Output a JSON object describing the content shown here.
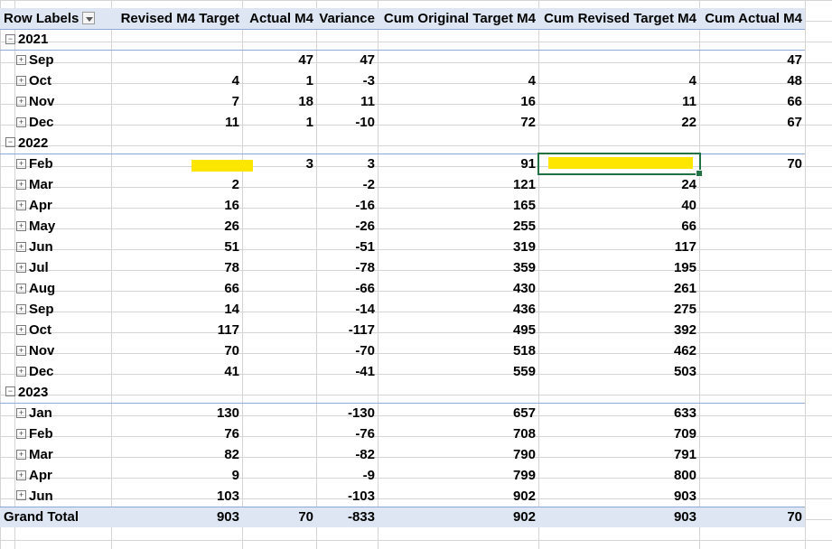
{
  "columns": [
    "Row Labels",
    "Revised M4 Target",
    "Actual M4",
    "Variance",
    "Cum Original Target M4",
    "Cum Revised Target M4",
    "Cum Actual M4"
  ],
  "rows": [
    {
      "kind": "year",
      "label": "2021",
      "values": [
        "",
        "",
        "",
        "",
        "",
        ""
      ]
    },
    {
      "kind": "month",
      "label": "Sep",
      "values": [
        "",
        "47",
        "47",
        "",
        "",
        "47"
      ]
    },
    {
      "kind": "month",
      "label": "Oct",
      "values": [
        "4",
        "1",
        "-3",
        "4",
        "4",
        "48"
      ]
    },
    {
      "kind": "month",
      "label": "Nov",
      "values": [
        "7",
        "18",
        "11",
        "16",
        "11",
        "66"
      ]
    },
    {
      "kind": "month",
      "label": "Dec",
      "values": [
        "11",
        "1",
        "-10",
        "72",
        "22",
        "67"
      ]
    },
    {
      "kind": "year",
      "label": "2022",
      "values": [
        "",
        "",
        "",
        "",
        "",
        ""
      ]
    },
    {
      "kind": "month",
      "label": "Feb",
      "values": [
        "",
        "3",
        "3",
        "91",
        "",
        "70"
      ]
    },
    {
      "kind": "month",
      "label": "Mar",
      "values": [
        "2",
        "",
        "-2",
        "121",
        "24",
        ""
      ]
    },
    {
      "kind": "month",
      "label": "Apr",
      "values": [
        "16",
        "",
        "-16",
        "165",
        "40",
        ""
      ]
    },
    {
      "kind": "month",
      "label": "May",
      "values": [
        "26",
        "",
        "-26",
        "255",
        "66",
        ""
      ]
    },
    {
      "kind": "month",
      "label": "Jun",
      "values": [
        "51",
        "",
        "-51",
        "319",
        "117",
        ""
      ]
    },
    {
      "kind": "month",
      "label": "Jul",
      "values": [
        "78",
        "",
        "-78",
        "359",
        "195",
        ""
      ]
    },
    {
      "kind": "month",
      "label": "Aug",
      "values": [
        "66",
        "",
        "-66",
        "430",
        "261",
        ""
      ]
    },
    {
      "kind": "month",
      "label": "Sep",
      "values": [
        "14",
        "",
        "-14",
        "436",
        "275",
        ""
      ]
    },
    {
      "kind": "month",
      "label": "Oct",
      "values": [
        "117",
        "",
        "-117",
        "495",
        "392",
        ""
      ]
    },
    {
      "kind": "month",
      "label": "Nov",
      "values": [
        "70",
        "",
        "-70",
        "518",
        "462",
        ""
      ]
    },
    {
      "kind": "month",
      "label": "Dec",
      "values": [
        "41",
        "",
        "-41",
        "559",
        "503",
        ""
      ]
    },
    {
      "kind": "year",
      "label": "2023",
      "values": [
        "",
        "",
        "",
        "",
        "",
        ""
      ]
    },
    {
      "kind": "month",
      "label": "Jan",
      "values": [
        "130",
        "",
        "-130",
        "657",
        "633",
        ""
      ]
    },
    {
      "kind": "month",
      "label": "Feb",
      "values": [
        "76",
        "",
        "-76",
        "708",
        "709",
        ""
      ]
    },
    {
      "kind": "month",
      "label": "Mar",
      "values": [
        "82",
        "",
        "-82",
        "790",
        "791",
        ""
      ]
    },
    {
      "kind": "month",
      "label": "Apr",
      "values": [
        "9",
        "",
        "-9",
        "799",
        "800",
        ""
      ]
    },
    {
      "kind": "month",
      "label": "Jun",
      "values": [
        "103",
        "",
        "-103",
        "902",
        "903",
        ""
      ]
    }
  ],
  "grand_total": {
    "label": "Grand Total",
    "values": [
      "903",
      "70",
      "-833",
      "902",
      "903",
      "70"
    ]
  },
  "glyphs": {
    "collapse": "−",
    "expand": "+"
  },
  "colors": {
    "highlight": "#ffe600",
    "header_fill": "#dde6f2",
    "selection": "#217346"
  }
}
